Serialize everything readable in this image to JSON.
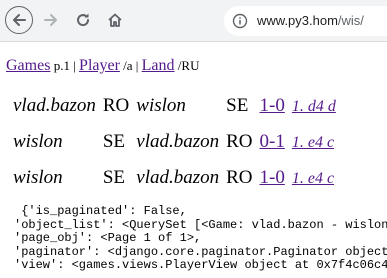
{
  "browser": {
    "url_host": "www.py3.hom",
    "url_path": "/wis/",
    "icons": [
      "back-arrow-icon",
      "forward-arrow-icon",
      "reload-icon",
      "home-icon",
      "info-icon"
    ]
  },
  "breadcrumb": {
    "games_link": "Games",
    "games_suffix": " p.1 | ",
    "player_link": "Player",
    "player_suffix": " /a | ",
    "land_link": "Land",
    "land_suffix": " /RU"
  },
  "games": [
    {
      "white": "vlad.bazon",
      "white_land": "RO",
      "black": "wislon",
      "black_land": "SE",
      "result": "1-0",
      "moves": "1. d4 d"
    },
    {
      "white": "wislon",
      "white_land": "SE",
      "black": "vlad.bazon",
      "black_land": "RO",
      "result": "0-1",
      "moves": "1. e4 c"
    },
    {
      "white": "wislon",
      "white_land": "SE",
      "black": "vlad.bazon",
      "black_land": "RO",
      "result": "1-0",
      "moves": "1. e4 c"
    }
  ],
  "debug_context": [
    " {'is_paginated': False,",
    "'object_list': <QuerySet [<Game: vlad.bazon - wislon (",
    "'page_obj': <Page 1 of 1>,",
    "'paginator': <django.core.paginator.Paginator object a",
    "'view': <games.views.PlayerView object at 0x7f4c06c494"
  ]
}
